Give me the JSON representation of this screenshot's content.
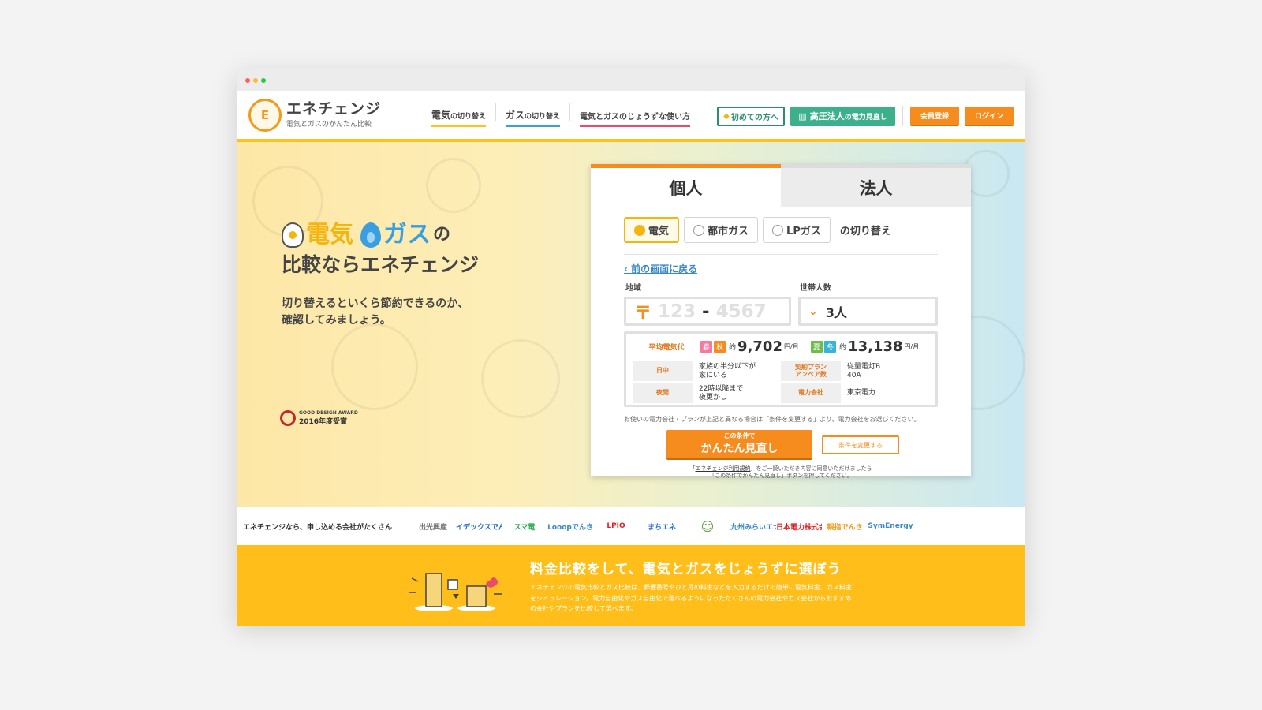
{
  "colors": {
    "accent": "#f68b1e",
    "yellow": "#ffc21c",
    "green": "#3cb08a",
    "electric": "#f5b50f",
    "gas": "#3a9fe0"
  },
  "logo": {
    "title": "エネチェンジ",
    "subtitle": "電気とガスのかんたん比較",
    "mark": "E"
  },
  "nav": [
    {
      "main": "電気",
      "small": "の切り替え",
      "color": "#ffc21c"
    },
    {
      "main": "ガス",
      "small": "の切り替え",
      "color": "#3a9fe0"
    },
    {
      "main": "電気とガスのじょうずな使い方",
      "small": "",
      "color": "#e94b6a"
    }
  ],
  "header_buttons": {
    "first": "初めての方へ",
    "corp_main": "高圧法人",
    "corp_small": "の電力見直し",
    "register": "会員登録",
    "login": "ログイン"
  },
  "hero": {
    "elec": "電気",
    "gas": "ガス",
    "no": "の",
    "line2": "比較ならエネチェンジ",
    "lead1": "切り替えるといくら節約できるのか、",
    "lead2": "確認してみましょう。",
    "award_t1": "GOOD DESIGN AWARD",
    "award_t2": "2016年度受賞"
  },
  "card": {
    "tab_personal": "個人",
    "tab_corporate": "法人",
    "type_elec": "電気",
    "type_city_gas": "都市ガス",
    "type_lp_gas": "LPガス",
    "type_suffix": "の切り替え",
    "back": "前の画面に戻る",
    "label_area": "地域",
    "label_household": "世帯人数",
    "zip_icon": "〒",
    "zip_a": "123",
    "zip_dash": "-",
    "zip_b": "4567",
    "household_value": "3人",
    "avg_label": "平均電気代",
    "b_spring": "春",
    "b_autumn": "秋",
    "b_summer": "夏",
    "b_winter": "冬",
    "yaku": "約",
    "amt1": "9,702",
    "amt2": "13,138",
    "per_month": "円/月",
    "k_day": "日中",
    "v_day_1": "家族の半分以下が",
    "v_day_2": "家にいる",
    "k_night": "夜間",
    "v_night_1": "22時以降まで",
    "v_night_2": "夜更かし",
    "k_plan_1": "契約プラン",
    "k_plan_2": "アンペア数",
    "v_plan_1": "従量電灯B",
    "v_plan_2": "40A",
    "k_company": "電力会社",
    "v_company": "東京電力",
    "note": "お使いの電力会社・プランが上記と異なる場合は「条件を変更する」より、電力会社をお選びください。",
    "go_small": "この条件で",
    "go_large": "かんたん見直し",
    "change": "条件を変更する",
    "terms_link": "エネチェンジ利用規約",
    "terms_1": "をご一読いただき内容に同意いただけましたら",
    "terms_2": "「この条件でかんたん見直し」ボタンを押してください。",
    "terms_open": "「",
    "terms_close": "」"
  },
  "partners": {
    "lead": "エネチェンジなら、申し込める会社がたくさん",
    "logos": [
      {
        "name": "出光興産",
        "color": "#777"
      },
      {
        "name": "イデックスでんき",
        "color": "#2a6fc9"
      },
      {
        "name": "スマ電",
        "color": "#2aa84a"
      },
      {
        "name": "Looopでんき",
        "color": "#3a88c9"
      },
      {
        "name": "LPIO",
        "color": "#d9262c"
      },
      {
        "name": "まちエネ",
        "color": "#2a6fc9"
      },
      {
        "name": "",
        "color": "#5aa03a"
      },
      {
        "name": "九州みらいエナジー",
        "color": "#3a88c9"
      },
      {
        "name": "日本電力株式会社",
        "color": "#d9262c"
      },
      {
        "name": "親指でんき",
        "color": "#f39a1b"
      },
      {
        "name": "SymEnergy",
        "color": "#3a88c9"
      }
    ]
  },
  "promo": {
    "title": "料金比較をして、電気とガスをじょうずに選ぼう",
    "text": "エネチェンジの電気比較とガス比較は、郵便番号やひと月の料金などを入力するだけで簡単に電気料金、ガス料金をシミュレーション。電力自由化やガス自由化で選べるようになったたくさんの電力会社やガス会社からおすすめの会社やプランを比較して選べます。"
  }
}
